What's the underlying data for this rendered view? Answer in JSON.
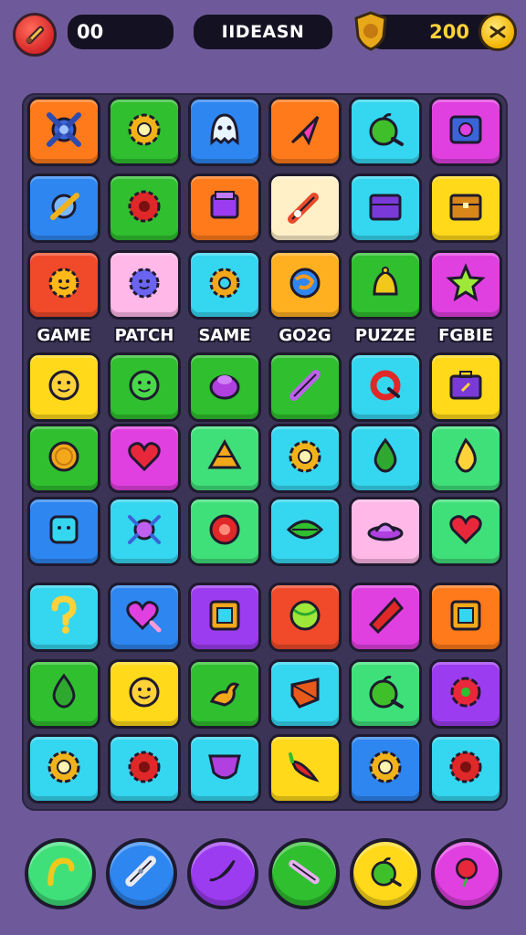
{
  "header": {
    "counter": "00",
    "title": "IIDEASN",
    "coins": "200",
    "tool_icon": "wrench-icon",
    "badge_icon": "trophy-shield-icon",
    "coin_icon": "coin-icon"
  },
  "colors": {
    "background": "#6e5a9a",
    "board": "#3b3456",
    "orange": "#ff7a1a",
    "green": "#2fbf2f",
    "blue": "#2e86f0",
    "cyan": "#35d6f0",
    "purple": "#9c3cf0",
    "yellow": "#ffd91a",
    "pink": "#ffb8e8",
    "lightgreen": "#3fe07a",
    "red": "#f04a2a",
    "magenta": "#e040e0",
    "cream": "#fff0c8",
    "gold": "#ffb020"
  },
  "categories": [
    {
      "label": "GAME"
    },
    {
      "label": "PATCH"
    },
    {
      "label": "SAME"
    },
    {
      "label": "GO2G"
    },
    {
      "label": "PUZZE"
    },
    {
      "label": "FGBIE"
    }
  ],
  "board": {
    "rows": [
      [
        {
          "color": "orange",
          "icon": "x-gear-icon"
        },
        {
          "color": "green",
          "icon": "gear-icon"
        },
        {
          "color": "blue",
          "icon": "ghost-icon"
        },
        {
          "color": "orange",
          "icon": "arrow-cursor-icon"
        },
        {
          "color": "cyan",
          "icon": "apple-icon"
        },
        {
          "color": "magenta",
          "icon": "safe-icon"
        }
      ],
      [
        {
          "color": "blue",
          "icon": "rocket-icon"
        },
        {
          "color": "green",
          "icon": "cog-icon"
        },
        {
          "color": "orange",
          "icon": "box-icon"
        },
        {
          "color": "cream",
          "icon": "syringe-icon"
        },
        {
          "color": "cyan",
          "icon": "chest-icon"
        },
        {
          "color": "yellow",
          "icon": "treasure-chest-icon"
        }
      ],
      [
        {
          "color": "red",
          "icon": "sun-gear-icon"
        },
        {
          "color": "pink",
          "icon": "smiley-gear-icon"
        },
        {
          "color": "cyan",
          "icon": "donut-gear-icon"
        },
        {
          "color": "gold",
          "icon": "swirl-icon"
        },
        {
          "color": "green",
          "icon": "bell-icon"
        },
        {
          "color": "magenta",
          "icon": "star-icon"
        }
      ],
      [
        {
          "color": "yellow",
          "icon": "smiley-icon"
        },
        {
          "color": "green",
          "icon": "face-icon"
        },
        {
          "color": "green",
          "icon": "blob-icon"
        },
        {
          "color": "green",
          "icon": "tube-icon"
        },
        {
          "color": "cyan",
          "icon": "ring-icon"
        },
        {
          "color": "yellow",
          "icon": "briefcase-icon"
        }
      ],
      [
        {
          "color": "green",
          "icon": "coin-icon"
        },
        {
          "color": "magenta",
          "icon": "heart-icon"
        },
        {
          "color": "lightgreen",
          "icon": "pyramid-icon"
        },
        {
          "color": "cyan",
          "icon": "gear-icon"
        },
        {
          "color": "cyan",
          "icon": "drop-icon"
        },
        {
          "color": "lightgreen",
          "icon": "flame-icon"
        }
      ],
      [
        {
          "color": "blue",
          "icon": "gear-face-icon"
        },
        {
          "color": "cyan",
          "icon": "bug-icon"
        },
        {
          "color": "lightgreen",
          "icon": "target-icon"
        },
        {
          "color": "cyan",
          "icon": "leaf-icon"
        },
        {
          "color": "pink",
          "icon": "ufo-icon"
        },
        {
          "color": "lightgreen",
          "icon": "heart-icon"
        }
      ],
      [
        {
          "color": "cyan",
          "icon": "question-icon"
        },
        {
          "color": "blue",
          "icon": "heart-tag-icon"
        },
        {
          "color": "purple",
          "icon": "frame-icon"
        },
        {
          "color": "red",
          "icon": "ball-icon"
        },
        {
          "color": "magenta",
          "icon": "kite-icon"
        },
        {
          "color": "orange",
          "icon": "frame-icon"
        }
      ],
      [
        {
          "color": "green",
          "icon": "drop-icon"
        },
        {
          "color": "yellow",
          "icon": "smiley-icon"
        },
        {
          "color": "green",
          "icon": "duck-icon"
        },
        {
          "color": "cyan",
          "icon": "gem-icon"
        },
        {
          "color": "lightgreen",
          "icon": "apple-icon"
        },
        {
          "color": "purple",
          "icon": "flower-icon"
        }
      ],
      [
        {
          "color": "cyan",
          "icon": "gear-icon"
        },
        {
          "color": "cyan",
          "icon": "cog-icon"
        },
        {
          "color": "cyan",
          "icon": "shield-icon"
        },
        {
          "color": "yellow",
          "icon": "chili-icon"
        },
        {
          "color": "blue",
          "icon": "gear-icon"
        },
        {
          "color": "cyan",
          "icon": "cog-icon"
        }
      ]
    ]
  },
  "tray": [
    {
      "color": "lightgreen",
      "icon": "hook-icon"
    },
    {
      "color": "blue",
      "icon": "bandage-icon"
    },
    {
      "color": "purple",
      "icon": "banana-icon"
    },
    {
      "color": "green",
      "icon": "bat-icon"
    },
    {
      "color": "yellow",
      "icon": "apple-icon"
    },
    {
      "color": "magenta",
      "icon": "balloon-icon"
    }
  ]
}
